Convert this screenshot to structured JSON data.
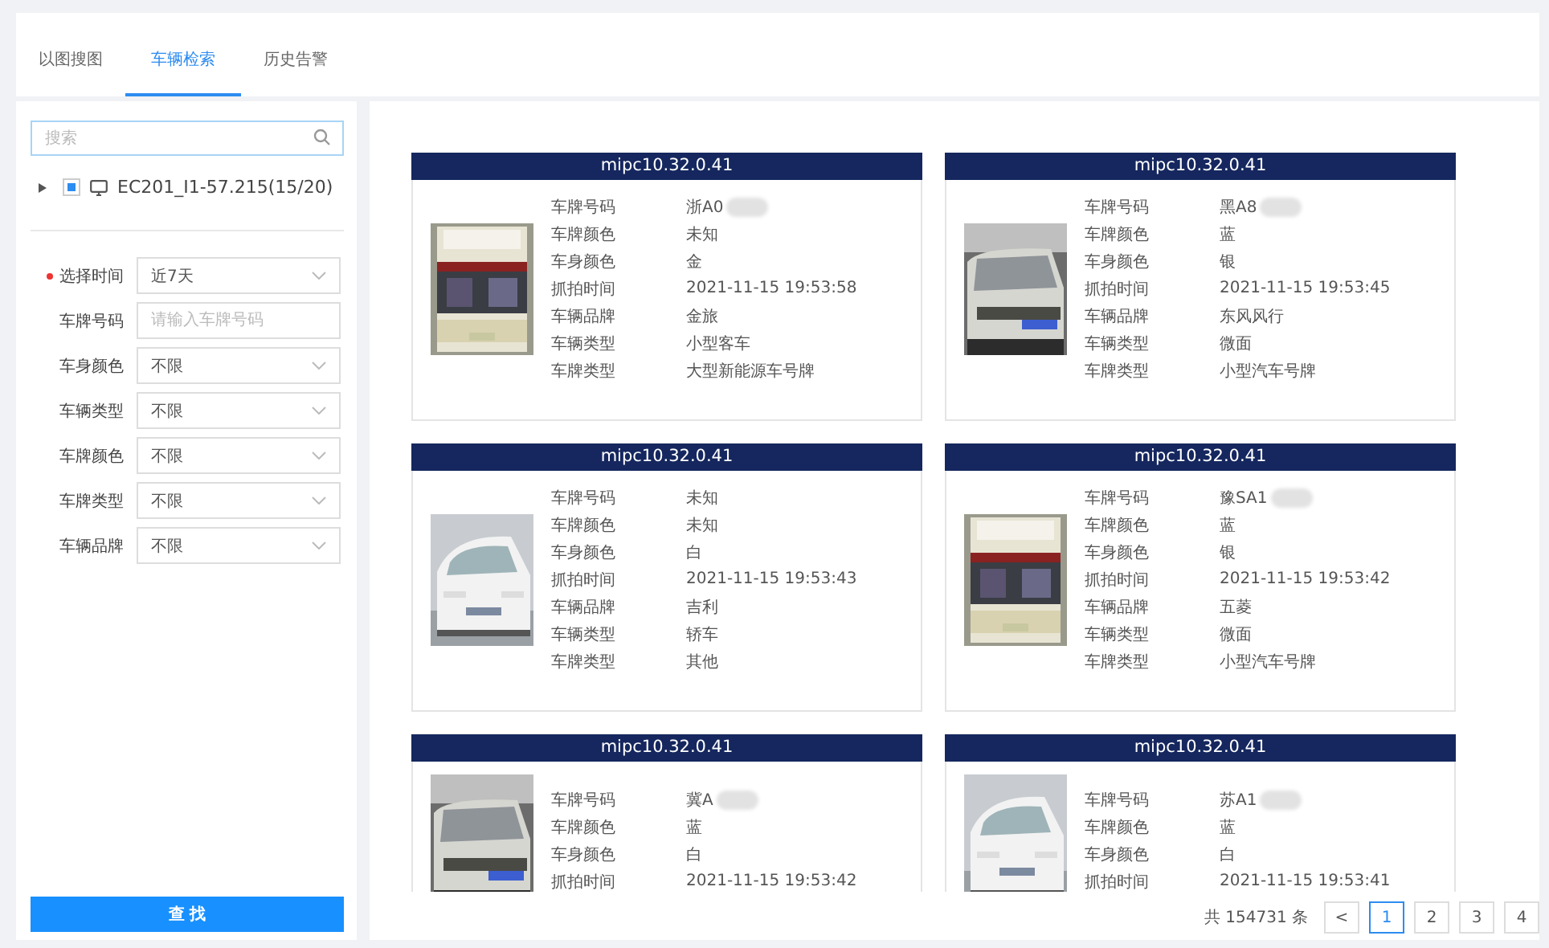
{
  "tabs": [
    {
      "label": "以图搜图",
      "selected": false
    },
    {
      "label": "车辆检索",
      "selected": true
    },
    {
      "label": "历史告警",
      "selected": false
    }
  ],
  "sidebar": {
    "search": {
      "placeholder": "搜索"
    },
    "tree": [
      {
        "label": "EC201_I1-57.215(15/20)",
        "expanded": false,
        "checked": true
      }
    ],
    "filters": [
      {
        "label": "选择时间",
        "required": true,
        "kind": "select",
        "value": "近7天"
      },
      {
        "label": "车牌号码",
        "required": false,
        "kind": "input",
        "placeholder": "请输入车牌号码"
      },
      {
        "label": "车身颜色",
        "required": false,
        "kind": "select",
        "value": "不限"
      },
      {
        "label": "车辆类型",
        "required": false,
        "kind": "select",
        "value": "不限"
      },
      {
        "label": "车牌颜色",
        "required": false,
        "kind": "select",
        "value": "不限"
      },
      {
        "label": "车牌类型",
        "required": false,
        "kind": "select",
        "value": "不限"
      },
      {
        "label": "车辆品牌",
        "required": false,
        "kind": "select",
        "value": "不限"
      }
    ],
    "search_button": "查 找"
  },
  "results": [
    {
      "title": "mipc10.32.0.41",
      "fields": [
        {
          "label": "车牌号码",
          "value": "浙A0",
          "masked": true
        },
        {
          "label": "车牌颜色",
          "value": "未知"
        },
        {
          "label": "车身颜色",
          "value": "金"
        },
        {
          "label": "抓拍时间",
          "value": "2021-11-15 19:53:58"
        },
        {
          "label": "车辆品牌",
          "value": "金旅"
        },
        {
          "label": "车辆类型",
          "value": "小型客车"
        },
        {
          "label": "车牌类型",
          "value": "大型新能源车号牌"
        }
      ]
    },
    {
      "title": "mipc10.32.0.41",
      "fields": [
        {
          "label": "车牌号码",
          "value": "黑A8",
          "masked": true
        },
        {
          "label": "车牌颜色",
          "value": "蓝"
        },
        {
          "label": "车身颜色",
          "value": "银"
        },
        {
          "label": "抓拍时间",
          "value": "2021-11-15 19:53:45"
        },
        {
          "label": "车辆品牌",
          "value": "东风风行"
        },
        {
          "label": "车辆类型",
          "value": "微面"
        },
        {
          "label": "车牌类型",
          "value": "小型汽车号牌"
        }
      ]
    },
    {
      "title": "mipc10.32.0.41",
      "fields": [
        {
          "label": "车牌号码",
          "value": "未知"
        },
        {
          "label": "车牌颜色",
          "value": "未知"
        },
        {
          "label": "车身颜色",
          "value": "白"
        },
        {
          "label": "抓拍时间",
          "value": "2021-11-15 19:53:43"
        },
        {
          "label": "车辆品牌",
          "value": "吉利"
        },
        {
          "label": "车辆类型",
          "value": "轿车"
        },
        {
          "label": "车牌类型",
          "value": "其他"
        }
      ]
    },
    {
      "title": "mipc10.32.0.41",
      "fields": [
        {
          "label": "车牌号码",
          "value": "豫SA1",
          "masked": true
        },
        {
          "label": "车牌颜色",
          "value": "蓝"
        },
        {
          "label": "车身颜色",
          "value": "银"
        },
        {
          "label": "抓拍时间",
          "value": "2021-11-15 19:53:42"
        },
        {
          "label": "车辆品牌",
          "value": "五菱"
        },
        {
          "label": "车辆类型",
          "value": "微面"
        },
        {
          "label": "车牌类型",
          "value": "小型汽车号牌"
        }
      ]
    },
    {
      "title": "mipc10.32.0.41",
      "fields": [
        {
          "label": "车牌号码",
          "value": "冀A",
          "masked": true
        },
        {
          "label": "车牌颜色",
          "value": "蓝"
        },
        {
          "label": "车身颜色",
          "value": "白"
        },
        {
          "label": "抓拍时间",
          "value": "2021-11-15 19:53:42"
        }
      ]
    },
    {
      "title": "mipc10.32.0.41",
      "fields": [
        {
          "label": "车牌号码",
          "value": "苏A1",
          "masked": true
        },
        {
          "label": "车牌颜色",
          "value": "蓝"
        },
        {
          "label": "车身颜色",
          "value": "白"
        },
        {
          "label": "抓拍时间",
          "value": "2021-11-15 19:53:41"
        }
      ]
    }
  ],
  "pagination": {
    "total": "共 154731 条",
    "prev": "<",
    "pages": [
      {
        "label": "1",
        "selected": true
      },
      {
        "label": "2",
        "selected": false
      },
      {
        "label": "3",
        "selected": false
      },
      {
        "label": "4",
        "selected": false
      }
    ]
  }
}
